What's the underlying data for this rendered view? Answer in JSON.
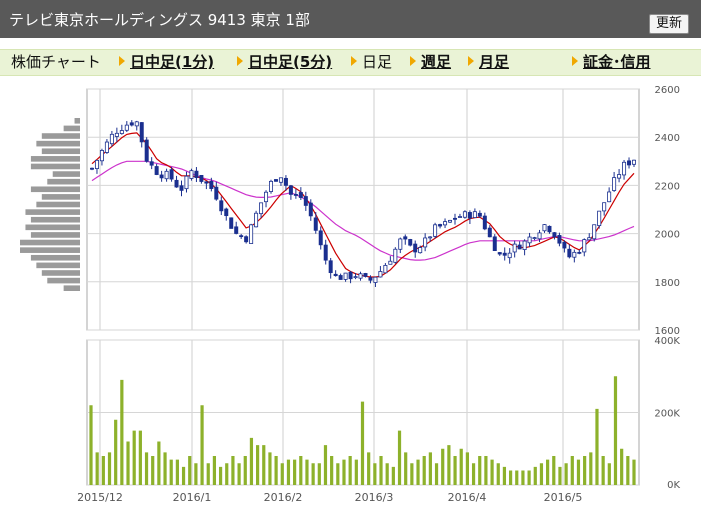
{
  "header": {
    "title": "テレビ東京ホールディングス  9413  東京 1部",
    "refresh_label": "更新"
  },
  "nav": {
    "label": "株価チャート",
    "intraday_1": "日中足(1分)",
    "intraday_5": "日中足(5分)",
    "daily": "日足",
    "weekly": "週足",
    "monthly": "月足",
    "margin": "証金･信用"
  },
  "colors": {
    "up": "#ffffff",
    "down": "#1a2f8f",
    "ma_short": "#cc0000",
    "ma_long": "#cc33cc",
    "volume": "#8db12b",
    "vol_profile": "#9a9a9a",
    "nav_bg": "#eaf3d6",
    "title_bg": "#595959"
  },
  "chart_data": [
    {
      "type": "candlestick",
      "title": "",
      "x_tick_labels": [
        "2015/12",
        "2016/1",
        "2016/2",
        "2016/3",
        "2016/4",
        "2016/5"
      ],
      "y_tick_labels": [
        "2600",
        "2400",
        "2200",
        "2000",
        "1800",
        "1600"
      ],
      "ylim": [
        1600,
        2600
      ],
      "grid": true,
      "price_path": [
        2270,
        2350,
        2420,
        2450,
        2470,
        2300,
        2250,
        2240,
        2180,
        2260,
        2220,
        2180,
        2080,
        2000,
        1980,
        2100,
        2200,
        2250,
        2160,
        2150,
        2050,
        1900,
        1820,
        1820,
        1830,
        1800,
        1840,
        1900,
        1980,
        1930,
        1960,
        2020,
        2040,
        2070,
        2080,
        2080,
        1980,
        1900,
        1940,
        1960,
        2000,
        2040,
        1990,
        1900,
        1930,
        2000,
        2100,
        2200,
        2280,
        2310
      ],
      "ma_short_path": [
        2290,
        2330,
        2370,
        2410,
        2420,
        2370,
        2300,
        2280,
        2240,
        2240,
        2230,
        2200,
        2140,
        2080,
        2020,
        2050,
        2100,
        2160,
        2200,
        2170,
        2100,
        2010,
        1920,
        1850,
        1830,
        1820,
        1820,
        1850,
        1900,
        1930,
        1950,
        1980,
        2010,
        2030,
        2060,
        2070,
        2040,
        1980,
        1950,
        1940,
        1950,
        1970,
        1990,
        1960,
        1930,
        1970,
        2040,
        2120,
        2200,
        2250
      ],
      "ma_long_path": [
        2220,
        2250,
        2280,
        2300,
        2300,
        2300,
        2290,
        2280,
        2270,
        2250,
        2230,
        2220,
        2200,
        2180,
        2160,
        2150,
        2150,
        2160,
        2170,
        2150,
        2120,
        2080,
        2040,
        2010,
        1990,
        1960,
        1930,
        1910,
        1900,
        1890,
        1890,
        1900,
        1920,
        1940,
        1960,
        1970,
        1970,
        1970,
        1970,
        1970,
        1970,
        1980,
        1990,
        1980,
        1970,
        1970,
        1980,
        1990,
        2010,
        2030
      ],
      "volume_profile": [
        1,
        3,
        7,
        8,
        7,
        9,
        9,
        5,
        6,
        9,
        7,
        8,
        10,
        9,
        10,
        9,
        11,
        11,
        9,
        8,
        7,
        6,
        3
      ],
      "candles": 50
    },
    {
      "type": "bar",
      "title": "",
      "x_tick_labels": [
        "2015/12",
        "2016/1",
        "2016/2",
        "2016/3",
        "2016/4",
        "2016/5"
      ],
      "y_tick_labels": [
        "400K",
        "200K",
        "0K"
      ],
      "ylim": [
        0,
        400000
      ],
      "values": [
        220000,
        90000,
        80000,
        90000,
        180000,
        290000,
        120000,
        150000,
        150000,
        90000,
        80000,
        120000,
        90000,
        70000,
        70000,
        50000,
        80000,
        60000,
        220000,
        60000,
        80000,
        50000,
        60000,
        80000,
        60000,
        80000,
        130000,
        110000,
        110000,
        90000,
        80000,
        60000,
        70000,
        70000,
        80000,
        70000,
        60000,
        60000,
        110000,
        80000,
        60000,
        70000,
        80000,
        70000,
        230000,
        90000,
        60000,
        80000,
        60000,
        50000,
        150000,
        90000,
        60000,
        70000,
        80000,
        90000,
        60000,
        100000,
        110000,
        80000,
        100000,
        90000,
        60000,
        80000,
        80000,
        70000,
        60000,
        50000,
        40000,
        40000,
        40000,
        40000,
        50000,
        60000,
        70000,
        80000,
        50000,
        60000,
        80000,
        70000,
        80000,
        90000,
        210000,
        80000,
        60000,
        300000,
        100000,
        80000,
        70000
      ]
    }
  ]
}
